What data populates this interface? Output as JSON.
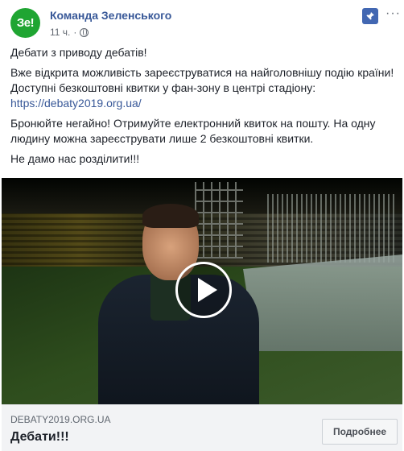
{
  "header": {
    "avatar_text": "Зе!",
    "page_name": "Команда Зеленського",
    "time": "11 ч.",
    "separator": "·",
    "more": "···"
  },
  "post": {
    "paragraphs": [
      "Дебати з приводу дебатів!",
      "Вже відкрита можливість зареєструватися на найголовнішу подію країни! Доступні безкоштовні квитки у фан-зону в центрі стадіону:",
      "Бронюйте негайно! Отримуйте електронний квиток на пошту. На одну людину можна зареєструвати лише 2 безкоштовні квитки.",
      "Не дамо нас розділити!!!"
    ],
    "link": "https://debaty2019.org.ua/"
  },
  "link_preview": {
    "domain": "DEBATY2019.ORG.UA",
    "title": "Дебати!!!",
    "cta_label": "Подробнее"
  },
  "colors": {
    "brand_green": "#1fa532",
    "link_blue": "#385898",
    "pin_blue": "#4267b2"
  }
}
